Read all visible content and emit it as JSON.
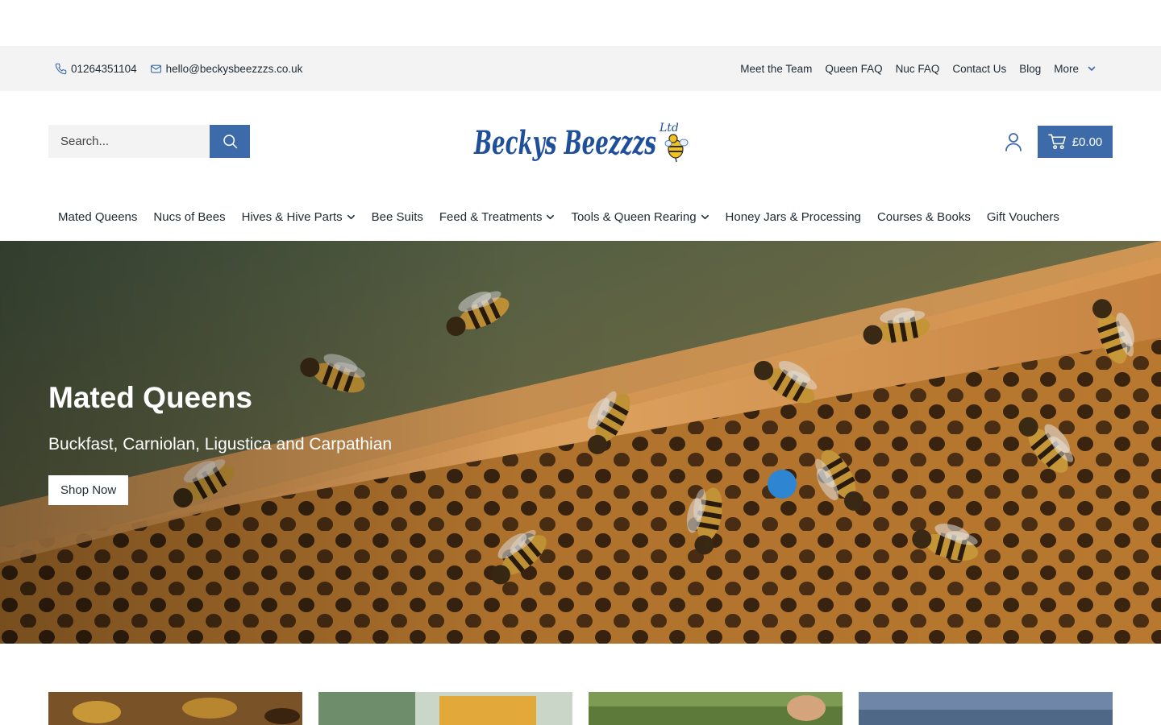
{
  "utility": {
    "phone": "01264351104",
    "email": "hello@beckysbeezzzs.co.uk",
    "links": [
      "Meet the Team",
      "Queen FAQ",
      "Nuc FAQ",
      "Contact Us",
      "Blog"
    ],
    "more_label": "More"
  },
  "header": {
    "search_placeholder": "Search...",
    "logo_text": "Beckys Beezzzs",
    "logo_suffix": "Ltd",
    "cart_total": "£0.00"
  },
  "nav": {
    "items": [
      {
        "label": "Mated Queens",
        "dropdown": false
      },
      {
        "label": "Nucs of Bees",
        "dropdown": false
      },
      {
        "label": "Hives & Hive Parts",
        "dropdown": true
      },
      {
        "label": "Bee Suits",
        "dropdown": false
      },
      {
        "label": "Feed & Treatments",
        "dropdown": true
      },
      {
        "label": "Tools & Queen Rearing",
        "dropdown": true
      },
      {
        "label": "Honey Jars & Processing",
        "dropdown": false
      },
      {
        "label": "Courses & Books",
        "dropdown": false
      },
      {
        "label": "Gift Vouchers",
        "dropdown": false
      }
    ]
  },
  "hero": {
    "title": "Mated Queens",
    "subtitle": "Buckfast, Carniolan, Ligustica and Carpathian",
    "cta": "Shop Now"
  },
  "colors": {
    "brand_blue": "#3d6aa8",
    "utility_bg": "#f3f3f3",
    "text": "#1f2a33"
  },
  "icons": {
    "phone": "phone-icon",
    "email": "mail-icon",
    "more": "chevron-down-icon",
    "search": "search-icon",
    "account": "user-icon",
    "cart": "cart-icon",
    "dropdown": "chevron-down-icon"
  }
}
